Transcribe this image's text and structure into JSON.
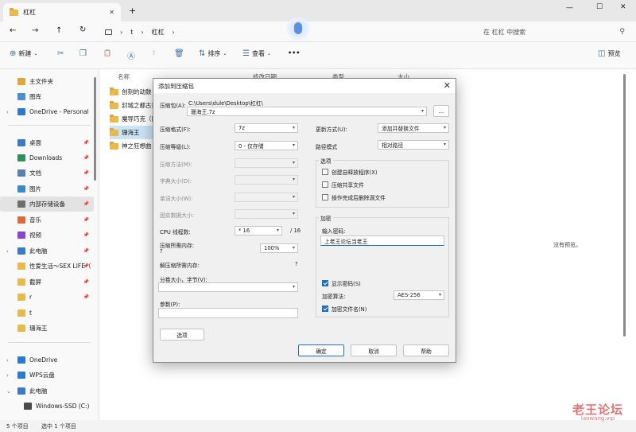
{
  "window": {
    "tab_title": "杠杠",
    "close_tab": "✕",
    "new_tab": "+",
    "controls": {
      "minimize": "—",
      "maximize": "☐",
      "close": "✕"
    }
  },
  "nav": {
    "back": "←",
    "forward": "→",
    "up": "↑",
    "refresh": "↻",
    "path": [
      "t",
      "杠杠"
    ],
    "search_placeholder": "在 杠杠 中搜索"
  },
  "toolbar": {
    "new": "新建",
    "sort": "排序",
    "view": "查看",
    "more": "•••",
    "preview": "预览"
  },
  "sidebar": {
    "items": [
      {
        "label": "主文件夹",
        "color": "#e0a935"
      },
      {
        "label": "图库",
        "color": "#4a8fd6"
      },
      {
        "label": "OneDrive - Personal",
        "color": "#2a7ad0"
      },
      {
        "label": "桌面",
        "color": "#3a7bc8"
      },
      {
        "label": "Downloads",
        "color": "#2f8f5b"
      },
      {
        "label": "文档",
        "color": "#5a7fb4"
      },
      {
        "label": "图片",
        "color": "#3d86d0"
      },
      {
        "label": "内部存储设备",
        "color": "#6f6f6f"
      },
      {
        "label": "音乐",
        "color": "#e0683a"
      },
      {
        "label": "视频",
        "color": "#8a45c8"
      },
      {
        "label": "此电脑",
        "color": "#3a7bc8"
      },
      {
        "label": "性爱生活～SEX LIFE（",
        "color": "#e9b949"
      },
      {
        "label": "截屏",
        "color": "#e9b949"
      },
      {
        "label": "r",
        "color": "#e9b949"
      },
      {
        "label": "t",
        "color": "#e9b949"
      },
      {
        "label": "珊海王",
        "color": "#e9b949"
      },
      {
        "label": "OneDrive",
        "color": "#2a7ad0"
      },
      {
        "label": "WPS云盘",
        "color": "#2a7ad0"
      },
      {
        "label": "此电脑",
        "color": "#3a7bc8"
      },
      {
        "label": "Windows-SSD (C:)",
        "color": "#4a4a4a"
      }
    ]
  },
  "main": {
    "columns": [
      "名称",
      "修改日期",
      "类型",
      "大小"
    ],
    "files": [
      "创刻的动鼓",
      "封城之都古拉",
      "魔导巧克（副",
      "珊海王",
      "神之狂想曲"
    ],
    "no_preview": "没有预览。"
  },
  "status": {
    "count": "5 个项目",
    "selected": "选中 1 个项目"
  },
  "watermark": {
    "line1": "老王论坛",
    "line2": "laowang.vip"
  },
  "dialog": {
    "title": "添加到压缩包",
    "close": "✕",
    "archive_label": "压缩包(A):",
    "archive_path": "C:\\Users\\dule\\Desktop\\杠杠\\",
    "archive_name": "珊海王.7z",
    "browse": "...",
    "format_label": "压缩格式(F):",
    "format_value": "7z",
    "level_label": "压缩等级(L):",
    "level_value": "0 - 仅存储",
    "method_label": "压缩方法(M):",
    "dict_label": "字典大小(D):",
    "word_label": "单词大小(W):",
    "solid_label": "固实数据大小:",
    "cpu_label": "CPU 线程数:",
    "cpu_value": "* 16",
    "cpu_total": "/ 16",
    "mem_label": "压缩所需内存:",
    "mem_q": "?",
    "mem_value": "100%",
    "decomp_label": "解压缩所需内存:",
    "decomp_value": "?",
    "split_label": "分卷大小，字节(V):",
    "params_label": "参数(P):",
    "options_btn": "选项",
    "update_label": "更新方式(U):",
    "update_value": "添加并替换文件",
    "pathmode_label": "路径模式",
    "pathmode_value": "相对路径",
    "options_group": "选项",
    "opt_sfx": "创建自释放程序(X)",
    "opt_shared": "压缩共享文件",
    "opt_delete": "操作完成后删除源文件",
    "encrypt_group": "加密",
    "password_label": "输入密码:",
    "password_value": "上老王论坛当老王",
    "show_password": "显示密码(S)",
    "enc_method_label": "加密算法:",
    "enc_method_value": "AES-256",
    "enc_names": "加密文件名(N)",
    "ok": "确定",
    "cancel": "取消",
    "help": "帮助"
  }
}
